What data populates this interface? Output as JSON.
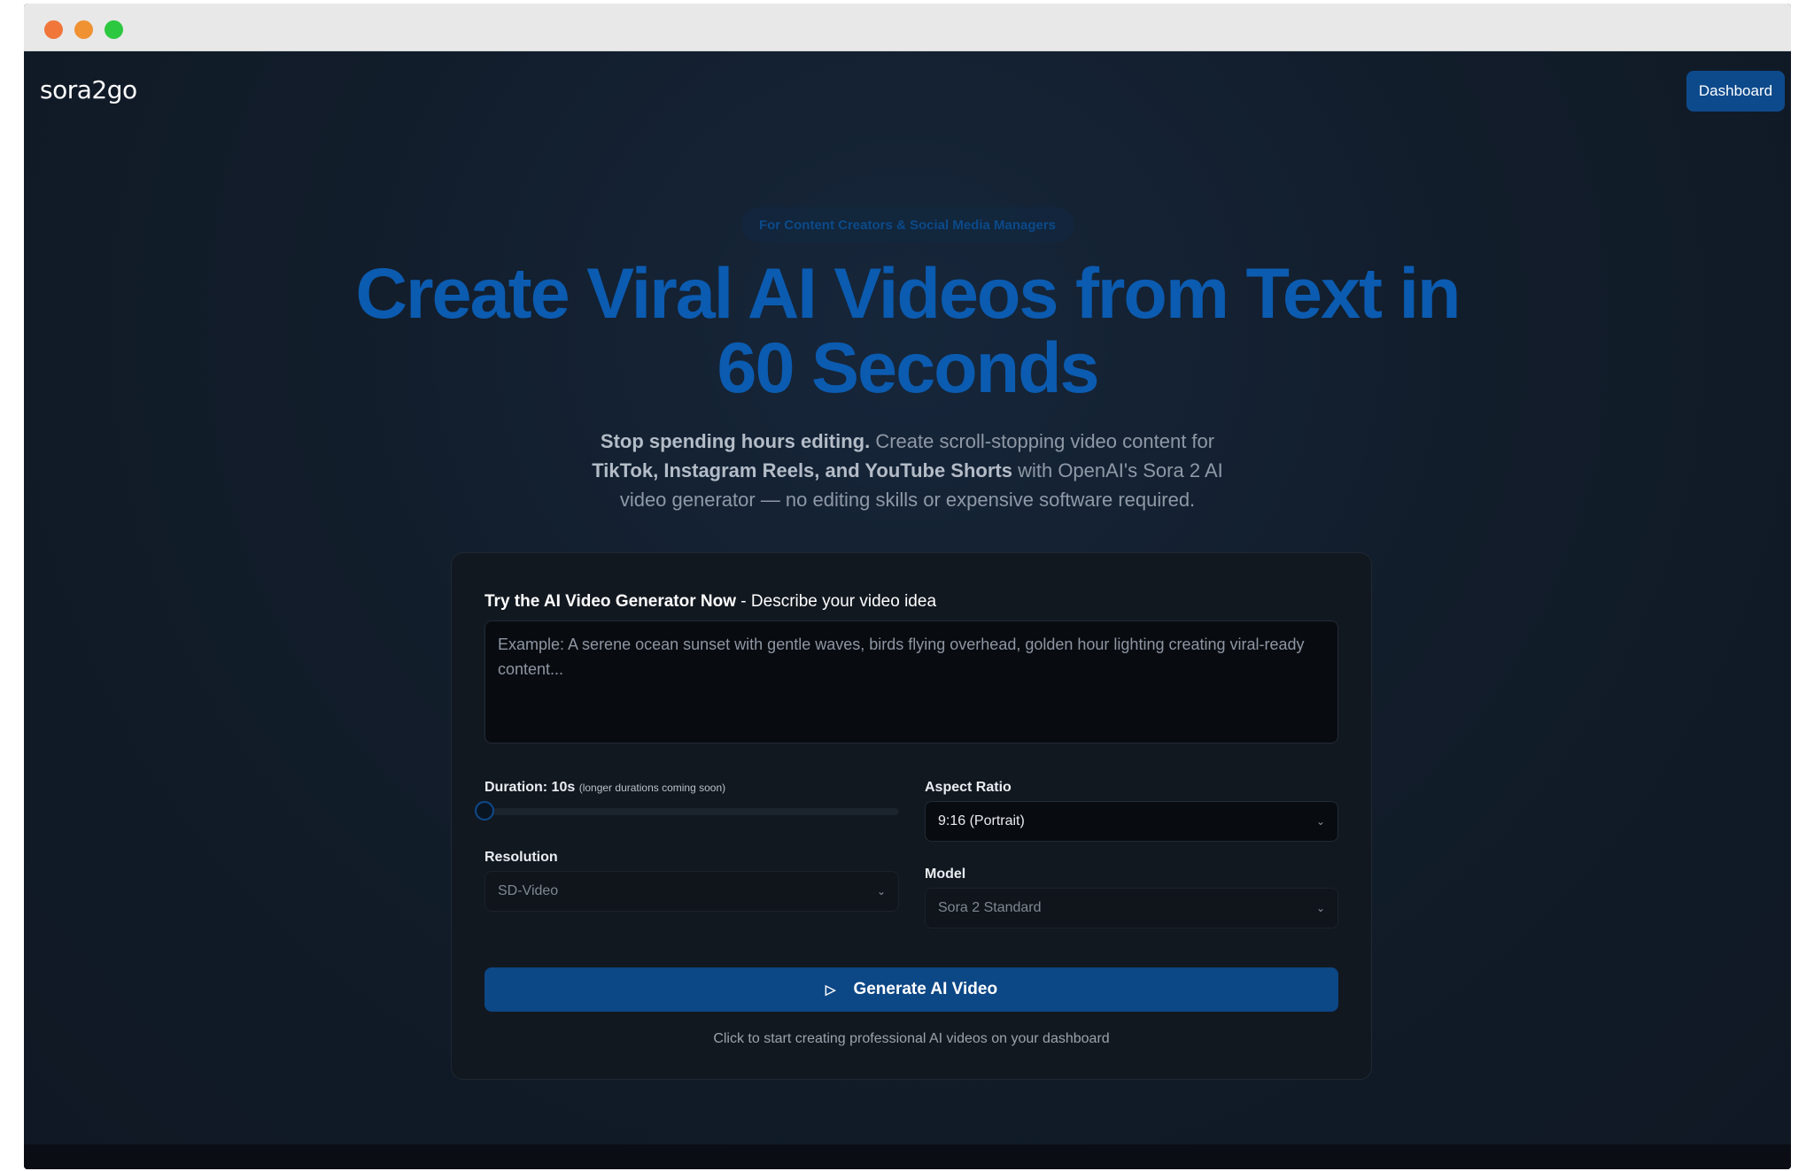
{
  "window": {
    "controls": [
      "close",
      "minimize",
      "maximize"
    ]
  },
  "header": {
    "logo": "sora2go",
    "dashboard_label": "Dashboard"
  },
  "hero": {
    "badge": "For Content Creators & Social Media Managers",
    "headline_line1": "Create Viral AI Videos from Text in",
    "headline_line2": "60 Seconds",
    "sub_bold1": "Stop spending hours editing.",
    "sub_text1": " Create scroll-stopping video content for ",
    "sub_bold2": "TikTok, Instagram Reels, and YouTube Shorts",
    "sub_text2": " with OpenAI's Sora 2 AI video generator — no editing skills or expensive software required."
  },
  "generator": {
    "title_bold": "Try the AI Video Generator Now",
    "title_rest": " - Describe your video idea",
    "prompt_placeholder": "Example: A serene ocean sunset with gentle waves, birds flying overhead, golden hour lighting creating viral-ready content...",
    "duration_label": "Duration: 10s",
    "duration_note": "(longer durations coming soon)",
    "duration_value_fraction": 0,
    "aspect_label": "Aspect Ratio",
    "aspect_value": "9:16 (Portrait)",
    "resolution_label": "Resolution",
    "resolution_value": "SD-Video",
    "model_label": "Model",
    "model_value": "Sora 2 Standard",
    "generate_label": "Generate AI Video",
    "hint": "Click to start creating professional AI videos on your dashboard"
  },
  "icons": {
    "play": "play-icon",
    "chevron": "chevron-down-icon"
  },
  "colors": {
    "accent": "#0d4a8c",
    "headline": "#0b5bb0",
    "background": "#111a26"
  }
}
